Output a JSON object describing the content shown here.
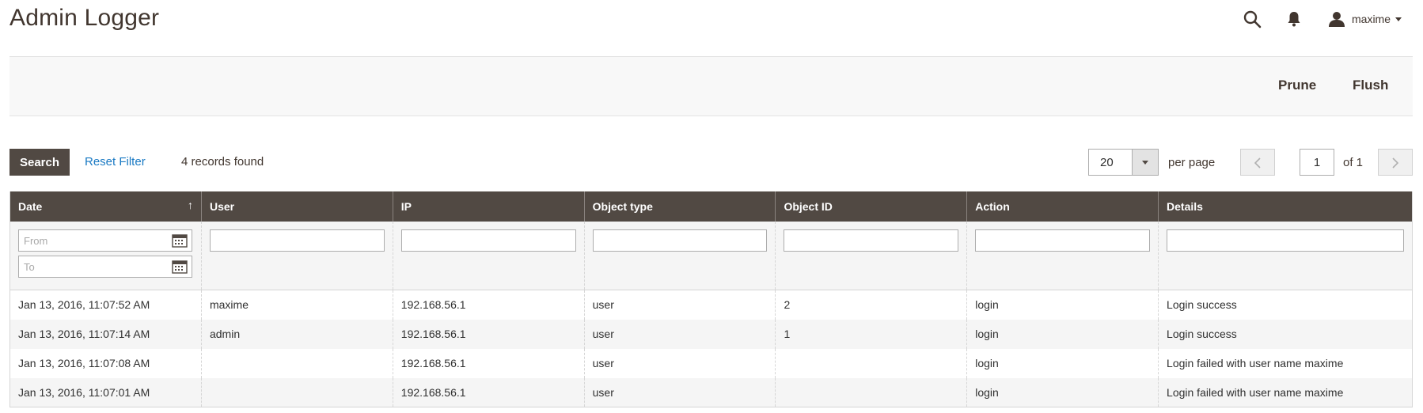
{
  "header": {
    "title": "Admin Logger",
    "username": "maxime"
  },
  "action_bar": {
    "prune_label": "Prune",
    "flush_label": "Flush"
  },
  "toolbar": {
    "search_label": "Search",
    "reset_filter_label": "Reset Filter",
    "records_found": "4 records found",
    "per_page_value": "20",
    "per_page_label": "per page",
    "current_page": "1",
    "of_pages": "of 1"
  },
  "grid": {
    "columns": [
      "Date",
      "User",
      "IP",
      "Object type",
      "Object ID",
      "Action",
      "Details"
    ],
    "sorted_column": "Date",
    "sort_direction": "ascending",
    "filters": {
      "date_from_placeholder": "From",
      "date_to_placeholder": "To"
    },
    "rows": [
      [
        "Jan 13, 2016, 11:07:52 AM",
        "maxime",
        "192.168.56.1",
        "user",
        "2",
        "login",
        "Login success"
      ],
      [
        "Jan 13, 2016, 11:07:14 AM",
        "admin",
        "192.168.56.1",
        "user",
        "1",
        "login",
        "Login success"
      ],
      [
        "Jan 13, 2016, 11:07:08 AM",
        "",
        "192.168.56.1",
        "user",
        "",
        "login",
        "Login failed with user name maxime"
      ],
      [
        "Jan 13, 2016, 11:07:01 AM",
        "",
        "192.168.56.1",
        "user",
        "",
        "login",
        "Login failed with user name maxime"
      ]
    ]
  },
  "icons": {
    "search": "search-icon",
    "notifications": "bell-icon",
    "user": "user-icon",
    "calendar": "calendar-icon",
    "prev": "chevron-left-icon",
    "next": "chevron-right-icon",
    "sort": "sort-arrow-icon"
  },
  "colors": {
    "header_bg": "#514943",
    "link": "#1979c3",
    "title": "#41362f"
  }
}
